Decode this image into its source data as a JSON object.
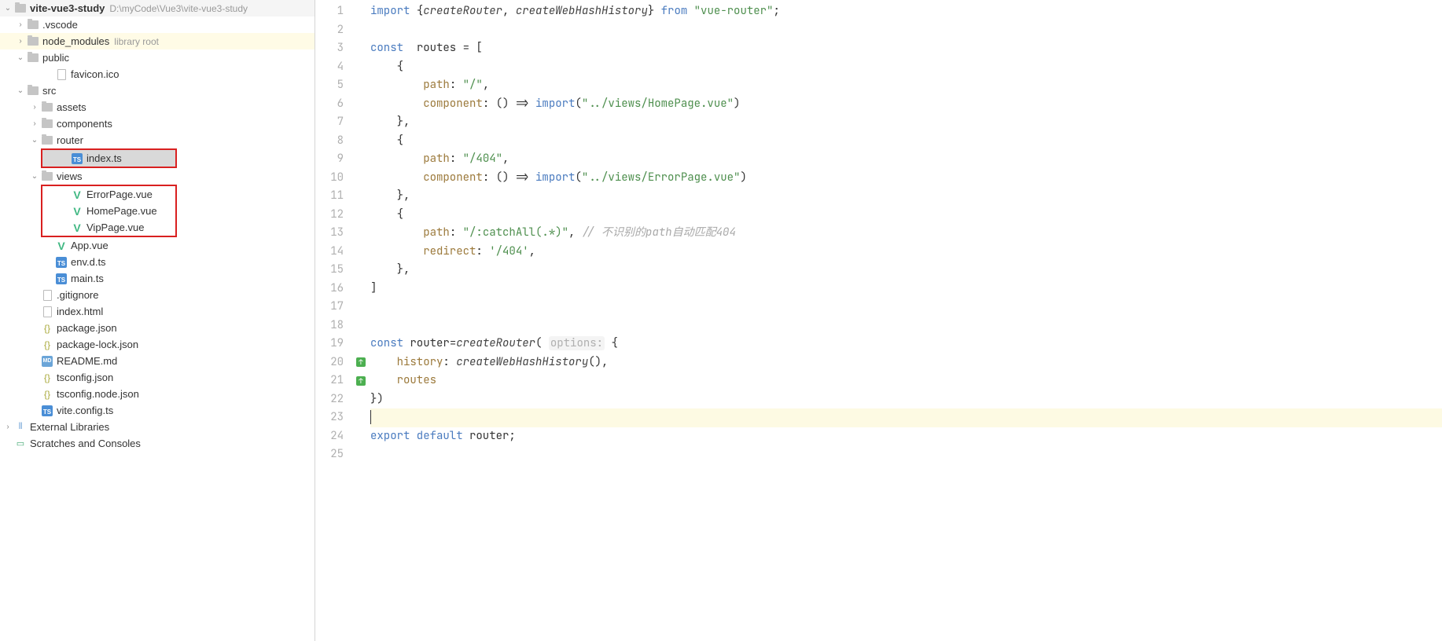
{
  "tree": {
    "root": {
      "name": "vite-vue3-study",
      "path": "D:\\myCode\\Vue3\\vite-vue3-study"
    },
    "vscode": ".vscode",
    "node_modules": {
      "name": "node_modules",
      "tag": "library root"
    },
    "public": "public",
    "favicon": "favicon.ico",
    "src": "src",
    "assets": "assets",
    "components": "components",
    "router": "router",
    "index_ts": "index.ts",
    "views": "views",
    "error_vue": "ErrorPage.vue",
    "home_vue": "HomePage.vue",
    "vip_vue": "VipPage.vue",
    "app_vue": "App.vue",
    "env_dts": "env.d.ts",
    "main_ts": "main.ts",
    "gitignore": ".gitignore",
    "index_html": "index.html",
    "package_json": "package.json",
    "package_lock": "package-lock.json",
    "readme": "README.md",
    "tsconfig": "tsconfig.json",
    "tsconfig_node": "tsconfig.node.json",
    "vite_config": "vite.config.ts",
    "ext_lib": "External Libraries",
    "scratches": "Scratches and Consoles"
  },
  "code": {
    "l1": {
      "a": "import ",
      "b": "{",
      "c": "createRouter",
      "d": ", ",
      "e": "createWebHashHistory",
      "f": "} ",
      "g": "from ",
      "h": "\"vue-router\"",
      "i": ";"
    },
    "l3": {
      "a": "const  ",
      "b": "routes = ["
    },
    "l4": "    {",
    "l5": {
      "a": "        ",
      "b": "path",
      "c": ": ",
      "d": "\"/\"",
      "e": ","
    },
    "l6": {
      "a": "        ",
      "b": "component",
      "c": ": () => ",
      "d": "import",
      "e": "(",
      "f": "\"../views/HomePage.vue\"",
      "g": ")"
    },
    "l7": "    },",
    "l8": "    {",
    "l9": {
      "a": "        ",
      "b": "path",
      "c": ": ",
      "d": "\"/404\"",
      "e": ","
    },
    "l10": {
      "a": "        ",
      "b": "component",
      "c": ": () => ",
      "d": "import",
      "e": "(",
      "f": "\"../views/ErrorPage.vue\"",
      "g": ")"
    },
    "l11": "    },",
    "l12": "    {",
    "l13": {
      "a": "        ",
      "b": "path",
      "c": ": ",
      "d": "\"/:catchAll(.*)\"",
      "e": ", ",
      "f": "// 不识别的path自动匹配404"
    },
    "l14": {
      "a": "        ",
      "b": "redirect",
      "c": ": ",
      "d": "'/404'",
      "e": ","
    },
    "l15": "    },",
    "l16": "]",
    "l19": {
      "a": "const ",
      "b": "router",
      "c": "=",
      "d": "createRouter",
      "e": "( ",
      "f": "options:",
      "g": " {"
    },
    "l20": {
      "a": "    ",
      "b": "history",
      "c": ": ",
      "d": "createWebHashHistory",
      "e": "(),"
    },
    "l21": {
      "a": "    ",
      "b": "routes"
    },
    "l22": "})",
    "l24": {
      "a": "export default ",
      "b": "router",
      "c": ";"
    }
  },
  "line_numbers": [
    "1",
    "2",
    "3",
    "4",
    "5",
    "6",
    "7",
    "8",
    "9",
    "10",
    "11",
    "12",
    "13",
    "14",
    "15",
    "16",
    "17",
    "18",
    "19",
    "20",
    "21",
    "22",
    "23",
    "24",
    "25"
  ]
}
